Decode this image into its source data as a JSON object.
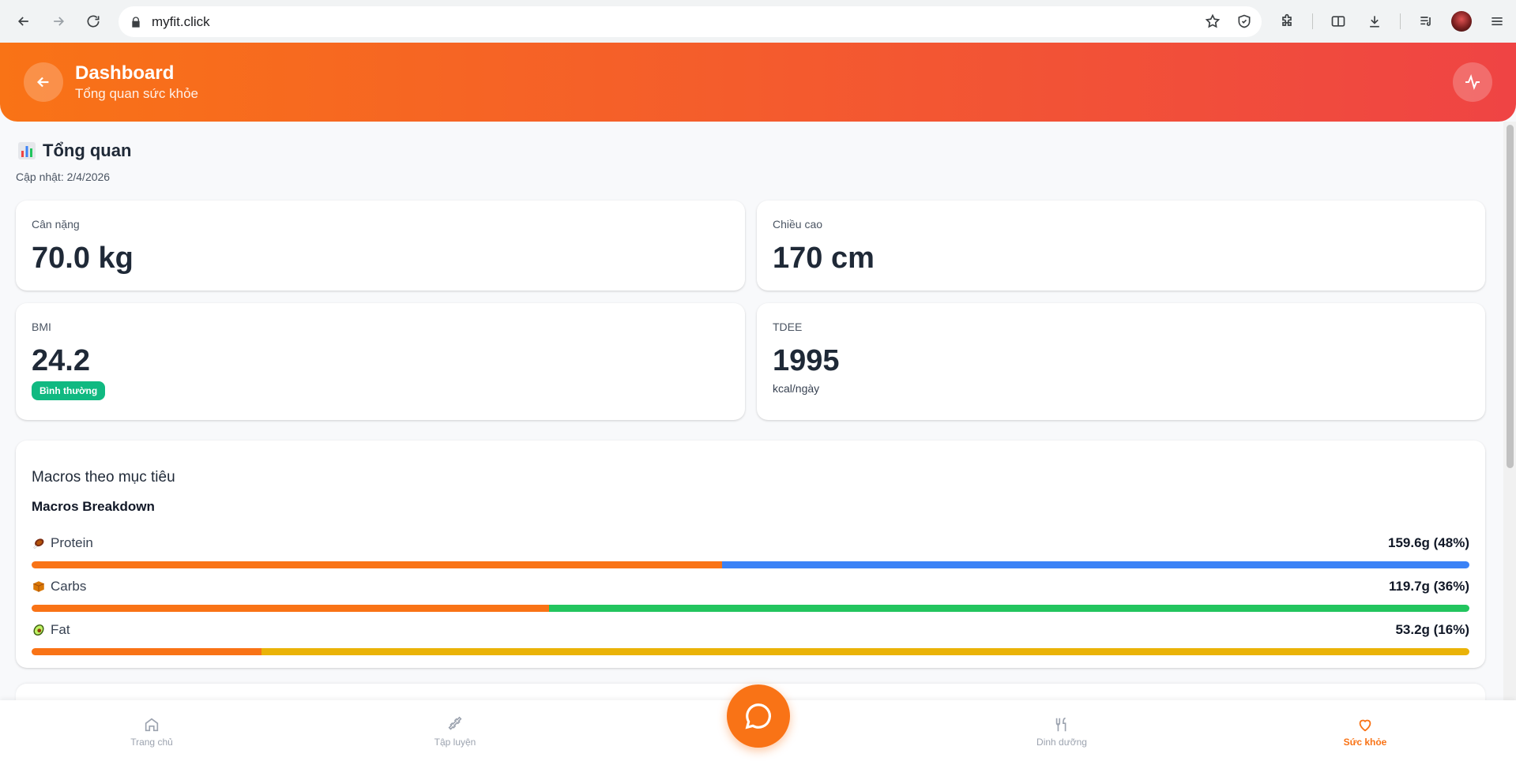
{
  "browser": {
    "url": "myfit.click"
  },
  "header": {
    "title": "Dashboard",
    "subtitle": "Tổng quan sức khỏe"
  },
  "overview": {
    "title": "Tổng quan",
    "updated": "Cập nhật: 2/4/2026"
  },
  "stats": {
    "weight": {
      "label": "Cân nặng",
      "value": "70.0 kg"
    },
    "height": {
      "label": "Chiều cao",
      "value": "170 cm"
    },
    "bmi": {
      "label": "BMI",
      "value": "24.2",
      "badge": "Bình thường",
      "badge_color": "#10b981"
    },
    "tdee": {
      "label": "TDEE",
      "value": "1995",
      "unit": "kcal/ngày"
    }
  },
  "macros": {
    "title": "Macros theo mục tiêu",
    "subtitle": "Macros Breakdown",
    "items": [
      {
        "name": "Protein",
        "icon": "meat-icon",
        "value": "159.6g (48%)",
        "fill_fraction": 0.48,
        "color": "#3b82f6"
      },
      {
        "name": "Carbs",
        "icon": "box-icon",
        "value": "119.7g (36%)",
        "fill_fraction": 0.36,
        "color": "#22c55e"
      },
      {
        "name": "Fat",
        "icon": "avocado-icon",
        "value": "53.2g (16%)",
        "fill_fraction": 0.16,
        "color": "#eab308"
      }
    ]
  },
  "bottom_nav": {
    "items": [
      {
        "label": "Trang chủ",
        "icon": "home-icon"
      },
      {
        "label": "Tập luyện",
        "icon": "dumbbell-icon"
      },
      {
        "label": "Dinh dưỡng",
        "icon": "utensils-icon"
      },
      {
        "label": "Sức khỏe",
        "icon": "heart-icon",
        "active": true
      }
    ]
  },
  "colors": {
    "accent": "#f97316",
    "header_gradient_end": "#ef4444"
  }
}
